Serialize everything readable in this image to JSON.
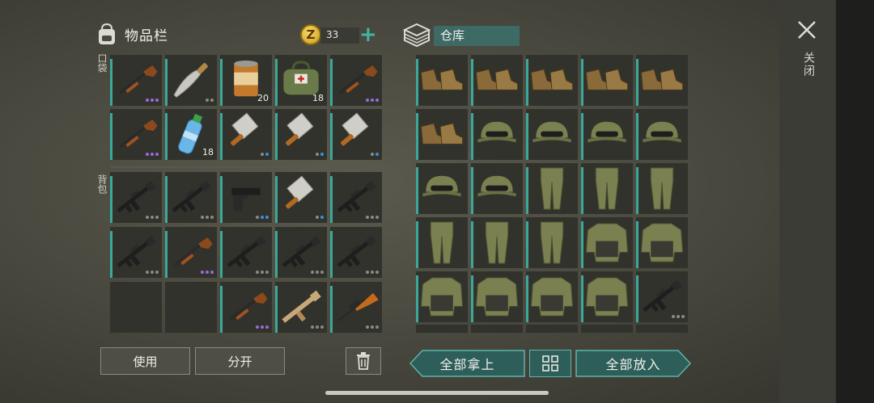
{
  "inventory": {
    "title": "物品栏",
    "coins": "33",
    "coin_symbol": "Z",
    "pockets_label": "口袋",
    "backpack_label": "背包"
  },
  "warehouse": {
    "title": "仓库"
  },
  "close_label": "关闭",
  "actions": {
    "use": "使用",
    "split": "分开",
    "take_all": "全部拿上",
    "put_all": "全部放入"
  },
  "colors": {
    "accent": "#3aa89a",
    "rarity_purple": "#9a6ad8",
    "rarity_blue": "#3d8fd8",
    "rarity_gray": "#8a8a82"
  },
  "pockets": [
    {
      "item": "shotgun",
      "dots": "ppp"
    },
    {
      "item": "machete",
      "dots": "gg"
    },
    {
      "item": "canned-food",
      "count": "20"
    },
    {
      "item": "first-aid-bag",
      "count": "18"
    },
    {
      "item": "shotgun",
      "dots": "ppp"
    },
    {
      "item": "shotgun",
      "dots": "ppp"
    },
    {
      "item": "water-bottle",
      "count": "18"
    },
    {
      "item": "cleaver",
      "dots": "gb"
    },
    {
      "item": "cleaver",
      "dots": "gb"
    },
    {
      "item": "cleaver",
      "dots": "gb"
    }
  ],
  "backpack": [
    {
      "item": "rifle",
      "dots": "ggg"
    },
    {
      "item": "rifle",
      "dots": "ggg"
    },
    {
      "item": "pistol",
      "dots": "gbb"
    },
    {
      "item": "cleaver",
      "dots": "gb"
    },
    {
      "item": "rifle",
      "dots": "ggg"
    },
    {
      "item": "rifle",
      "dots": "ggg"
    },
    {
      "item": "shotgun",
      "dots": "ppp"
    },
    {
      "item": "rifle",
      "dots": "ggg"
    },
    {
      "item": "rifle",
      "dots": "ggg"
    },
    {
      "item": "rifle",
      "dots": "ggg"
    },
    {
      "item": "empty"
    },
    {
      "item": "empty"
    },
    {
      "item": "shotgun",
      "dots": "ppp"
    },
    {
      "item": "scar-rifle",
      "dots": "ggg"
    },
    {
      "item": "hunting-rifle",
      "dots": "ggg"
    }
  ],
  "storage": [
    {
      "item": "boots"
    },
    {
      "item": "boots"
    },
    {
      "item": "boots"
    },
    {
      "item": "boots"
    },
    {
      "item": "boots"
    },
    {
      "item": "boots"
    },
    {
      "item": "camo-cap"
    },
    {
      "item": "camo-cap"
    },
    {
      "item": "camo-cap"
    },
    {
      "item": "camo-cap"
    },
    {
      "item": "camo-cap"
    },
    {
      "item": "camo-cap"
    },
    {
      "item": "camo-pants"
    },
    {
      "item": "camo-pants"
    },
    {
      "item": "camo-pants"
    },
    {
      "item": "camo-pants"
    },
    {
      "item": "camo-pants"
    },
    {
      "item": "camo-pants"
    },
    {
      "item": "camo-jacket"
    },
    {
      "item": "camo-jacket"
    },
    {
      "item": "camo-jacket"
    },
    {
      "item": "camo-jacket"
    },
    {
      "item": "camo-jacket"
    },
    {
      "item": "camo-jacket"
    },
    {
      "item": "rifle",
      "dots": "ggg"
    }
  ]
}
